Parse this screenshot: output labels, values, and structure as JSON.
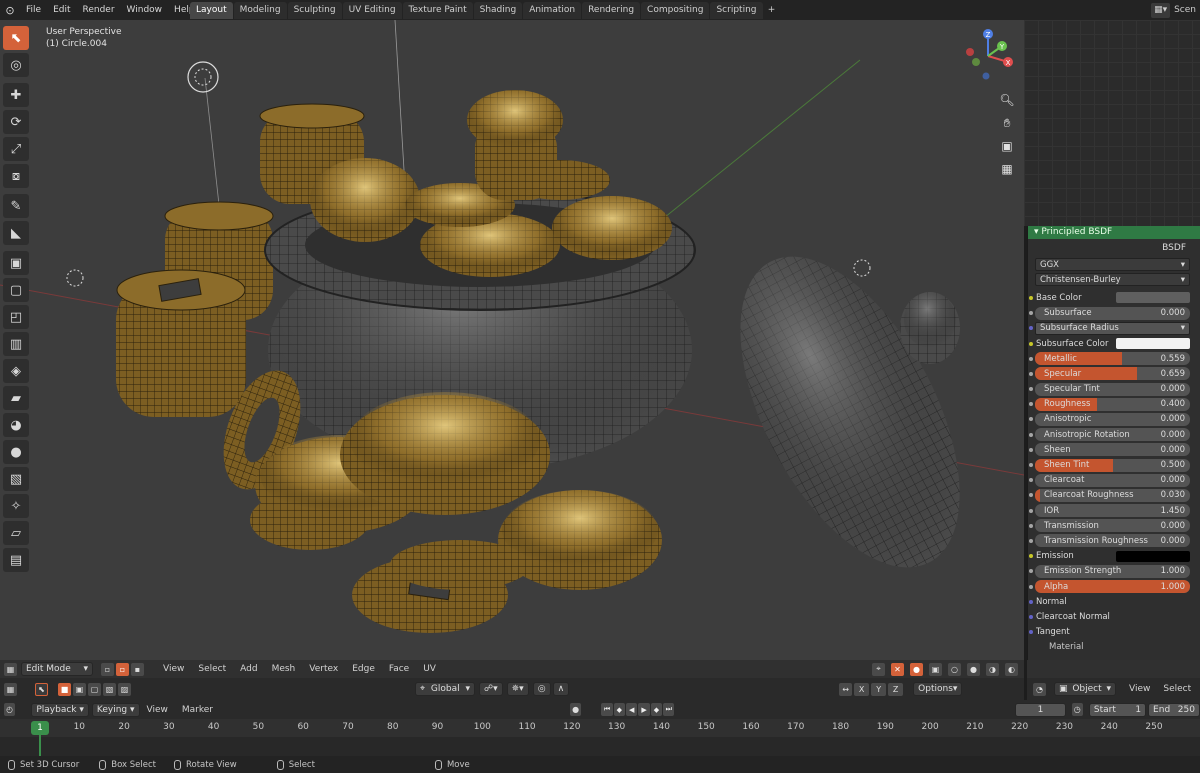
{
  "app": {
    "menus": [
      "File",
      "Edit",
      "Render",
      "Window",
      "Help"
    ],
    "workspaces": [
      {
        "label": "Layout",
        "active": true
      },
      {
        "label": "Modeling",
        "active": false
      },
      {
        "label": "Sculpting",
        "active": false
      },
      {
        "label": "UV Editing",
        "active": false
      },
      {
        "label": "Texture Paint",
        "active": false
      },
      {
        "label": "Shading",
        "active": false
      },
      {
        "label": "Animation",
        "active": false
      },
      {
        "label": "Rendering",
        "active": false
      },
      {
        "label": "Compositing",
        "active": false
      },
      {
        "label": "Scripting",
        "active": false
      }
    ],
    "add_workspace": "+",
    "scene_label": "Scen"
  },
  "viewport": {
    "view_name": "User Perspective",
    "object_name": "(1) Circle.004",
    "gizmo": {
      "x": "X",
      "y": "Y",
      "z": "Z"
    },
    "header": {
      "mode": "Edit Mode",
      "menus": [
        "View",
        "Select",
        "Add",
        "Mesh",
        "Vertex",
        "Edge",
        "Face",
        "UV"
      ]
    },
    "tool_header": {
      "transform_orientation": "Global",
      "axes": [
        "X",
        "Y",
        "Z"
      ],
      "options": "Options"
    }
  },
  "node": {
    "title": "Principled BSDF",
    "output": "BSDF",
    "distribution": "GGX",
    "subsurface_method": "Christensen-Burley",
    "rows": [
      {
        "type": "color",
        "label": "Base Color",
        "color": "#5f5f5f",
        "socket": "yel"
      },
      {
        "type": "value",
        "label": "Subsurface",
        "value": "0.000",
        "fill": 0
      },
      {
        "type": "select",
        "label": "Subsurface Radius",
        "socket": "blu"
      },
      {
        "type": "color",
        "label": "Subsurface Color",
        "color": "#f2f2f2",
        "socket": "yel"
      },
      {
        "type": "value",
        "label": "Metallic",
        "value": "0.559",
        "fill": 0.559
      },
      {
        "type": "value",
        "label": "Specular",
        "value": "0.659",
        "fill": 0.659
      },
      {
        "type": "value",
        "label": "Specular Tint",
        "value": "0.000",
        "fill": 0
      },
      {
        "type": "value",
        "label": "Roughness",
        "value": "0.400",
        "fill": 0.4
      },
      {
        "type": "value",
        "label": "Anisotropic",
        "value": "0.000",
        "fill": 0
      },
      {
        "type": "value",
        "label": "Anisotropic Rotation",
        "value": "0.000",
        "fill": 0
      },
      {
        "type": "value",
        "label": "Sheen",
        "value": "0.000",
        "fill": 0
      },
      {
        "type": "value",
        "label": "Sheen Tint",
        "value": "0.500",
        "fill": 0.5
      },
      {
        "type": "value",
        "label": "Clearcoat",
        "value": "0.000",
        "fill": 0
      },
      {
        "type": "value",
        "label": "Clearcoat Roughness",
        "value": "0.030",
        "fill": 0.03
      },
      {
        "type": "value",
        "label": "IOR",
        "value": "1.450",
        "fill": 0
      },
      {
        "type": "value",
        "label": "Transmission",
        "value": "0.000",
        "fill": 0
      },
      {
        "type": "value",
        "label": "Transmission Roughness",
        "value": "0.000",
        "fill": 0
      },
      {
        "type": "color",
        "label": "Emission",
        "color": "#000000",
        "socket": "yel"
      },
      {
        "type": "value",
        "label": "Emission Strength",
        "value": "1.000",
        "fill": 0
      },
      {
        "type": "value",
        "label": "Alpha",
        "value": "1.000",
        "fill": 1
      },
      {
        "type": "label",
        "label": "Normal",
        "socket": "blu"
      },
      {
        "type": "label",
        "label": "Clearcoat Normal",
        "socket": "blu"
      },
      {
        "type": "label",
        "label": "Tangent",
        "socket": "blu"
      }
    ],
    "footer_label": "Material"
  },
  "right_header": {
    "object": "Object",
    "view": "View",
    "select": "Select"
  },
  "timeline": {
    "playback": "Playback",
    "keying": "Keying",
    "view": "View",
    "marker": "Marker",
    "current_frame": "1",
    "start_label": "Start",
    "start": "1",
    "end_label": "End",
    "end": "250",
    "ticks": [
      "10",
      "20",
      "30",
      "40",
      "50",
      "60",
      "70",
      "80",
      "90",
      "100",
      "110",
      "120",
      "130",
      "140",
      "150",
      "160",
      "170",
      "180",
      "190",
      "200",
      "210",
      "220",
      "230",
      "240",
      "250"
    ],
    "playhead": "1"
  },
  "status": {
    "items": [
      "Set 3D Cursor",
      "Box Select",
      "Rotate View",
      "Select",
      "Move"
    ]
  },
  "colors": {
    "accent": "#d4623a",
    "node_header": "#2f7a44",
    "playhead": "#3a8f4b",
    "gold": "#8a6a2a"
  }
}
